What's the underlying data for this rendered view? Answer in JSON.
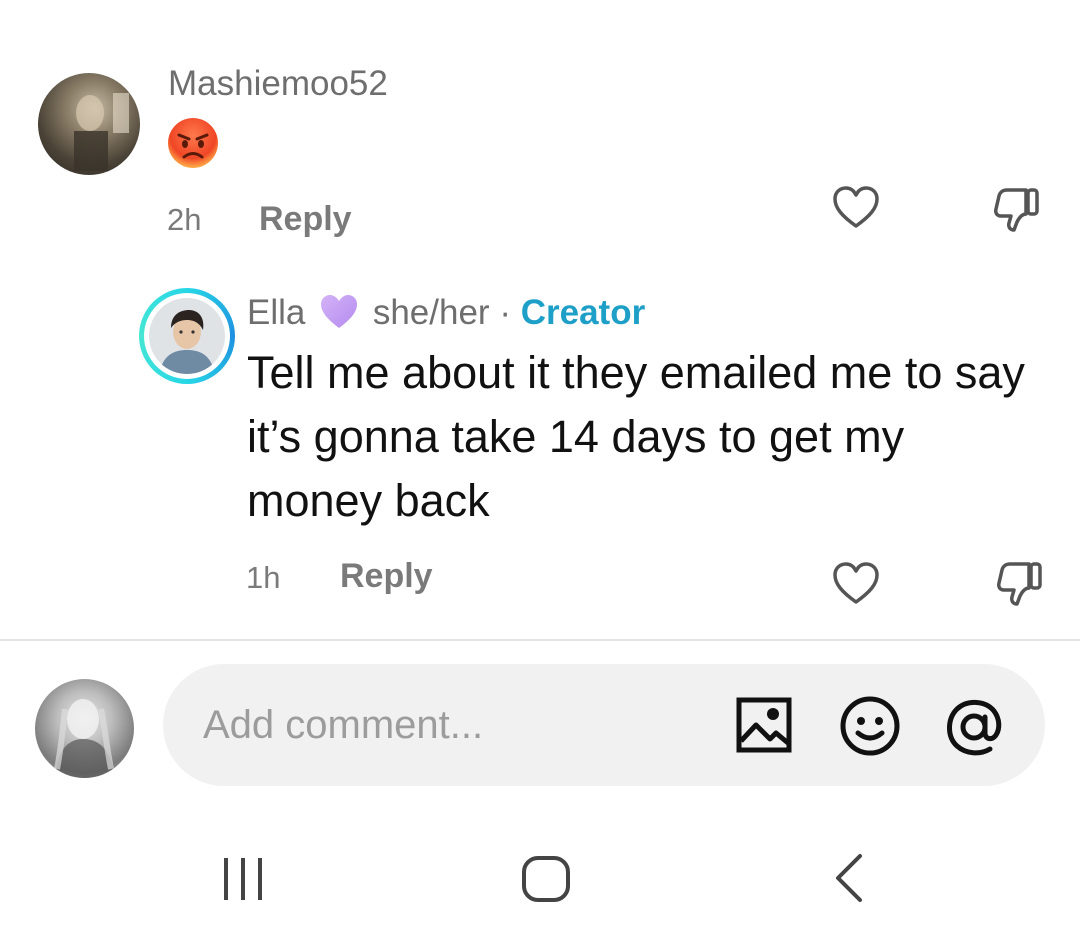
{
  "comments": [
    {
      "username": "Mashiemoo52",
      "emoji": "😡",
      "time": "2h",
      "reply_label": "Reply"
    }
  ],
  "replies": [
    {
      "username": "Ella",
      "heart_emoji": "💜",
      "pronouns": "she/her",
      "separator": "·",
      "badge": "Creator",
      "text": "Tell me about it they emailed me to say it’s gonna take 14 days to get my money back",
      "time": "1h",
      "reply_label": "Reply"
    }
  ],
  "composer": {
    "placeholder": "Add comment..."
  },
  "colors": {
    "creator": "#1e9fc7",
    "meta_gray": "#7a7a7a",
    "input_bg": "#f1f1f2"
  },
  "icons": {
    "like": "heart-outline-icon",
    "dislike": "thumbs-down-icon",
    "image": "image-icon",
    "emoji": "smiley-icon",
    "mention": "at-icon",
    "nav_recent": "recent-apps-icon",
    "nav_home": "home-icon",
    "nav_back": "back-icon"
  }
}
